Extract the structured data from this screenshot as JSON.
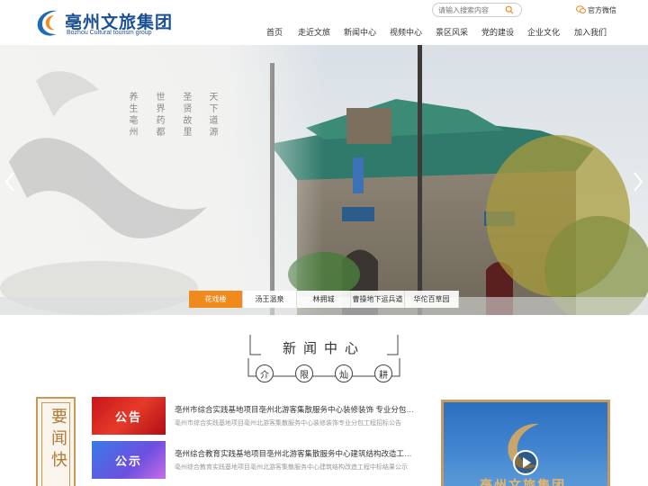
{
  "header": {
    "logo_cn": "亳州文旅集团",
    "logo_en": "Bozhou Cultural tourism group",
    "search_placeholder": "请输入搜索内容",
    "wechat_label": "官方微信"
  },
  "nav": [
    {
      "label": "首页"
    },
    {
      "label": "走近文旅"
    },
    {
      "label": "新闻中心"
    },
    {
      "label": "视频中心"
    },
    {
      "label": "景区风采"
    },
    {
      "label": "党的建设"
    },
    {
      "label": "企业文化"
    },
    {
      "label": "加入我们"
    }
  ],
  "banner": {
    "poems": [
      "天下道源",
      "圣贤故里",
      "世界药都",
      "养生亳州"
    ],
    "tabs": [
      {
        "label": "花戏楼",
        "active": true
      },
      {
        "label": "汤王温泉",
        "active": false
      },
      {
        "label": "林拥城",
        "active": false
      },
      {
        "label": "曹操地下运兵道",
        "active": false
      },
      {
        "label": "华佗百草园",
        "active": false
      }
    ]
  },
  "news": {
    "title": "新闻中心",
    "seals": [
      "介",
      "限",
      "灿",
      "耕"
    ],
    "side_text": "要闻快",
    "items": [
      {
        "thumb_text": "公告",
        "headline": "亳州市综合实践基地项目亳州北游客集散服务中心装修装饰 专业分包工程招标公告",
        "summary": "亳州市综合实践基地项目亳州北游客集散服务中心装修装饰专业分包工程招标公告"
      },
      {
        "thumb_text": "公示",
        "headline": "亳州综合教育实践基地项目亳州北游客集散服务中心建筑结构改造工程中标结果公示",
        "summary": "亳州综合教育实践基地项目亳州北游客集散服务中心建筑结构改造工程中标结果公示"
      }
    ],
    "video_caption": "亳州文旅集团"
  },
  "colors": {
    "brand_blue": "#1b4f93",
    "accent_orange": "#f08a1c",
    "gold": "#c69a5b"
  }
}
